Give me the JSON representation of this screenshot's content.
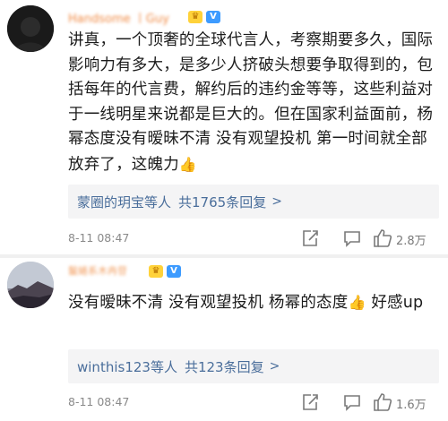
{
  "comments": [
    {
      "username": "Handsome 丨Guy",
      "text": "讲真，一个顶奢的全球代言人，考察期要多久，国际影响力有多大，是多少人挤破头想要争取得到的，包括每年的代言费，解约后的违约金等等，这些利益对于一线明星来说都是巨大的。但在国家利益面前，杨幂态度没有暧昧不清 没有观望投机 第一时间就全部放弃了，这魄力",
      "reply_summary": "蒙圈的玥宝等人",
      "reply_count": "共1765条回复",
      "timestamp": "8-11 08:47",
      "likes": "2.8万"
    },
    {
      "username": "鬣蜷系木冉苷",
      "text": "没有暧昧不清 没有观望投机 杨幂的态度",
      "text_after_emoji": " 好感up",
      "reply_summary": "winthis123等人",
      "reply_count": "共123条回复",
      "timestamp": "8-11 08:47",
      "likes": "1.6万"
    }
  ],
  "badges": {
    "crown": "♛",
    "v": "V"
  },
  "icons": {
    "thumb_emoji": "👍",
    "chevron": ">",
    "share": "share-icon",
    "comment": "comment-icon",
    "like": "like-icon"
  },
  "colors": {
    "link": "#4a6e9b",
    "username": "#f08a44",
    "meta": "#8a8a8a",
    "reply_bg": "#f4f4f5"
  }
}
